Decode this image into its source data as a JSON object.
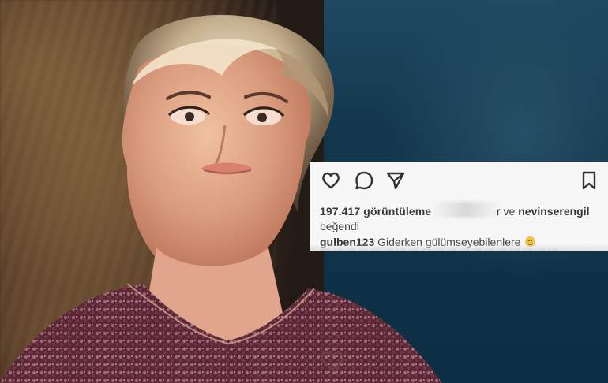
{
  "caption_card": {
    "views_text": "197.417 görüntüleme",
    "liked_by_prefix": "r ve",
    "liked_by_name": "nevinserengil",
    "liked_by_suffix": "beğendi",
    "username": "gulben123",
    "caption_text": "Giderken gülümseyebilenlere"
  },
  "icons": {
    "like": "heart-icon",
    "comment": "comment-icon",
    "share": "send-icon",
    "save": "bookmark-icon",
    "emoji": "smile-emoji-icon"
  },
  "colors": {
    "card_background": "#f7f7f7",
    "text_dark": "#333333",
    "teal_background": "#123a52"
  }
}
